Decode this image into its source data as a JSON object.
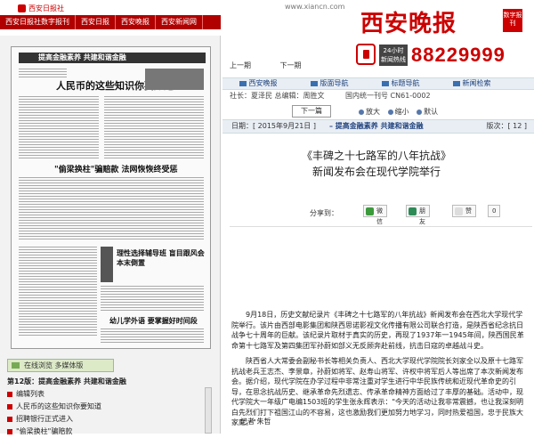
{
  "header": {
    "site_logo": "西安日报社",
    "nav": [
      "西安日报社数字报刊",
      "西安日报",
      "西安晚报",
      "西安新闻网"
    ],
    "url": "www.xiancn.com",
    "brand_title": "西安晚报",
    "brand_badge": "数字报刊",
    "hotline_label": "24小时 新闻热线",
    "hotline_number": "88229999"
  },
  "issue_nav": {
    "prev": "上一期",
    "next": "下一期"
  },
  "tabs": [
    "西安晚报",
    "版面导航",
    "标题导航",
    "新闻检索"
  ],
  "meta": {
    "editor": "社长：夏泽民  总编辑：周胜文",
    "number": "国内统一刊号 CN61-0002"
  },
  "toolbar": {
    "next_page": "下一篇",
    "zoom_in": "放大",
    "zoom_out": "缩小",
    "zoom_default": "默认"
  },
  "datebar": {
    "date": "日期：[ 2015年9月21日 ]",
    "section": "– 提高金融素养 共建和谐金融",
    "page": "版次：[ 12 ]"
  },
  "article": {
    "title_line1": "《丰碑之十七路军的八年抗战》",
    "title_line2": "新闻发布会在现代学院举行",
    "share_label": "分享到：",
    "share_buttons": [
      "微信",
      "朋友",
      "赞"
    ],
    "like_count": "0",
    "paragraphs": [
      "9月18日，历史文献纪录片《丰碑之十七路军的八年抗战》新闻发布会在西北大学现代学院举行。该片由西部电影集团和陕西思诺影视文化传播有限公司联合打造，是陕西省纪念抗日战争七十周年的巨献。该纪录片取材于真实的历史，再现了1937年一1945年间，陕西国民革命第十七路军及第四集团军孙蔚如部义无反顾奔赴前线，抗击日寇的卓越战斗史。",
      "陕西省人大常委会副秘书长等相关负责人、西北大学现代学院院长刘家全以及原十七路军抗战老兵王志杰、李景章，孙蔚如将军、赵寿山将军、许权中将军后人等出席了本次新闻发布会。据介绍，现代学院在办学过程中非常注重对学生进行中华民族传统和近现代革命史的引导，在思念抗战历史、继承革命先烈遗志、传承革命精神方面给过了丰厚的基础。活动中，现代学院大一年级广电编1503班的学生张永辉表示：\"今天的活动让我非常震撼，也让我深刻明白先烈们打下祖国江山的不容易，这也激励我们更加努力地学习，同时热爱祖国，忠于民族大家庭。\""
    ],
    "byline": "记者 朱哲"
  },
  "left_panel": {
    "scan_title": "提高金融素养 共建和谐金融",
    "scan_headline1": "人民币的这些知识你要知道",
    "scan_headline2": "\"偷梁换柱\"骗赔款  法网恢恢终受惩",
    "scan_headline3": "理性选择辅导班 盲目跟风会本末倒置",
    "scan_headline4": "幼儿学外语 要掌握好时间段",
    "online_tab": "在线浏览 多媒体版",
    "page_heading": "第12版：提高金融素养 共建和谐金融",
    "list_items": [
      "编辑列表",
      "人民币的这些知识你要知道",
      "招聘银行正式进入",
      "\"偷梁换柱\"骗赔款"
    ]
  }
}
